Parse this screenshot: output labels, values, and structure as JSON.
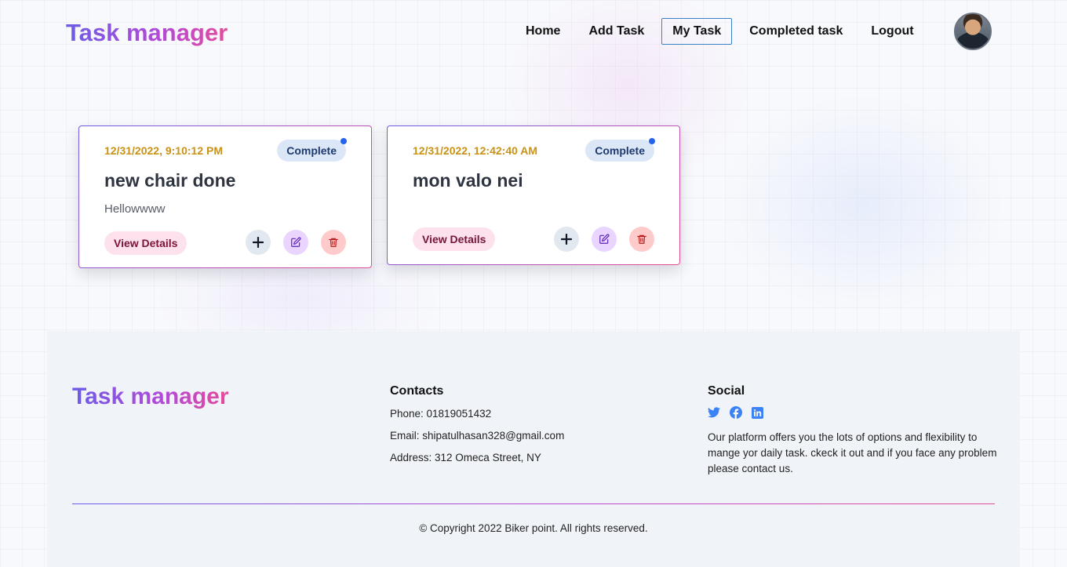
{
  "header": {
    "logo": "Task manager",
    "nav": [
      "Home",
      "Add Task",
      "My Task",
      "Completed task",
      "Logout"
    ],
    "active_nav": "My Task"
  },
  "tasks": [
    {
      "date": "12/31/2022, 9:10:12 PM",
      "status": "Complete",
      "title": "new chair done",
      "description": "Hellowwww",
      "view_label": "View Details"
    },
    {
      "date": "12/31/2022, 12:42:40 AM",
      "status": "Complete",
      "title": "mon valo nei",
      "description": "",
      "view_label": "View Details"
    }
  ],
  "footer": {
    "logo": "Task manager",
    "contacts": {
      "heading": "Contacts",
      "phone": "Phone: 01819051432",
      "email": "Email: shipatulhasan328@gmail.com",
      "address": "Address: 312 Omeca Street, NY"
    },
    "social": {
      "heading": "Social",
      "icons": [
        "twitter-icon",
        "facebook-icon",
        "linkedin-icon"
      ],
      "text": "Our platform offers you the lots of options and flexibility to mange yor daily task. ckeck it out and if you face any problem please contact us."
    },
    "copyright": "© Copyright 2022 Biker point. All rights reserved."
  },
  "colors": {
    "accent_gradient": [
      "#6d5ce6",
      "#e54b9a"
    ],
    "date_color": "#c99214",
    "badge_bg": "#dbe7f7",
    "social_blue": "#3b82f6"
  }
}
